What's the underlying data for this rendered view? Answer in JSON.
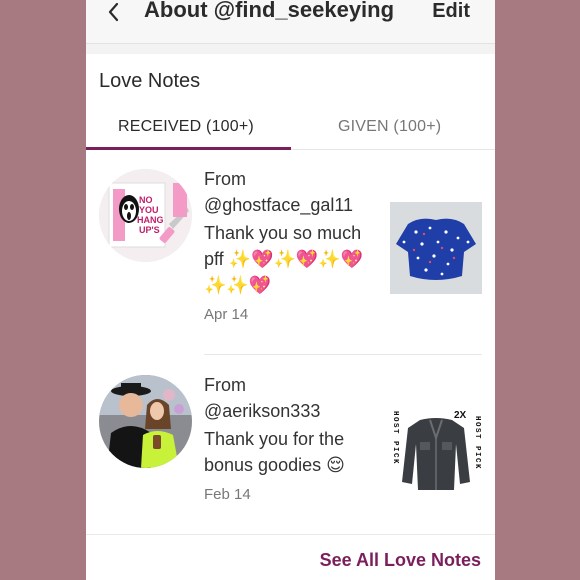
{
  "header": {
    "title": "About @find_seekeying",
    "edit_label": "Edit"
  },
  "section": {
    "title": "Love Notes"
  },
  "tabs": [
    {
      "label": "RECEIVED (100+)",
      "active": true
    },
    {
      "label": "GIVEN (100+)",
      "active": false
    }
  ],
  "notes": [
    {
      "from_label": "From",
      "user": "@ghostface_gal11",
      "message": "Thank you so much pff ✨💖✨💖✨💖✨✨💖",
      "date": "Apr 14",
      "item_icon": "blue-floral-top-image"
    },
    {
      "from_label": "From",
      "user": "@aerikson333",
      "message": "Thank you for the bonus goodies 😌",
      "date": "Feb 14",
      "item_icon": "denim-jacket-image",
      "badge_left": "HOST PICK",
      "badge_right": "HOST PICK",
      "badge_count": "2X"
    }
  ],
  "footer": {
    "see_all_label": "See All Love Notes"
  },
  "colors": {
    "background": "#a67a80",
    "accent": "#7a1f5c"
  }
}
